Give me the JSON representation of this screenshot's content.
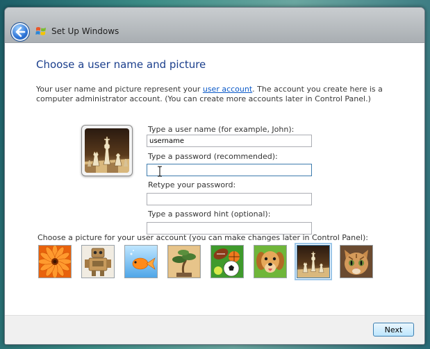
{
  "window": {
    "title": "Set Up Windows"
  },
  "page": {
    "heading": "Choose a user name and picture",
    "intro_pre": "Your user name and picture represent your ",
    "intro_link": "user account",
    "intro_post": ". The account you create here is a computer administrator account. (You can create more accounts later in Control Panel.)"
  },
  "form": {
    "username_label": "Type a user name (for example, John):",
    "username_value": "username",
    "password_label": "Type a password (recommended):",
    "password_value": "",
    "retype_label": "Retype your password:",
    "retype_value": "",
    "hint_label": "Type a password hint (optional):",
    "hint_value": ""
  },
  "pictures": {
    "label": "Choose a picture for your user account (you can make changes later in Control Panel):",
    "items": [
      {
        "icon": "flower-picture"
      },
      {
        "icon": "robot-picture"
      },
      {
        "icon": "goldfish-picture"
      },
      {
        "icon": "bonsai-picture"
      },
      {
        "icon": "sports-balls-picture"
      },
      {
        "icon": "puppy-picture"
      },
      {
        "icon": "chess-picture",
        "selected": true
      },
      {
        "icon": "kitten-picture"
      }
    ]
  },
  "footer": {
    "next_label": "Next"
  },
  "colors": {
    "heading": "#1a3e8c",
    "link": "#0a59c8",
    "selection": "#3d7bad"
  }
}
